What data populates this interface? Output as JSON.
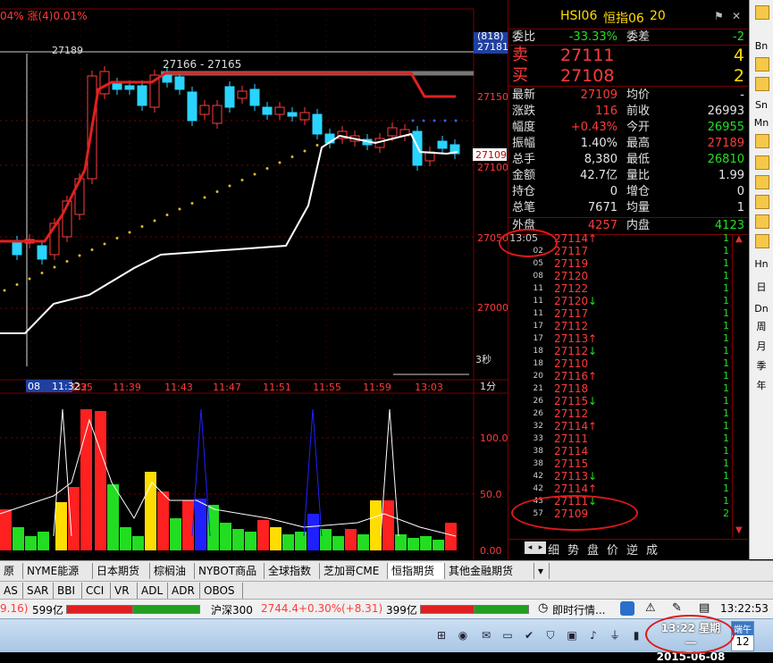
{
  "header": {
    "change_text": "04% 涨(4)0.01%"
  },
  "chart": {
    "price_labels": [
      "(818)",
      "27181",
      "27150",
      "27100",
      "27050",
      "27000"
    ],
    "current_price_tag": "27109",
    "high_annotation": "27189",
    "range_annotation": "27166 - 27165",
    "time_labels": [
      "11:32",
      "11:35",
      "11:39",
      "11:43",
      "11:47",
      "11:51",
      "11:55",
      "11:59",
      "13:03"
    ],
    "time_prefix": "08",
    "interval_label": "3秒",
    "period_label": "1分",
    "volume_labels": [
      "100.0",
      "50.0",
      "0.00"
    ]
  },
  "panel": {
    "symbol": "HSI06",
    "name": "恒指06",
    "number": "20",
    "weibi_label": "委比",
    "weibi_value": "-33.33%",
    "weicha_label": "委差",
    "weicha_value": "-2",
    "sell_label": "卖",
    "sell_price": "27111",
    "sell_qty": "4",
    "buy_label": "买",
    "buy_price": "27108",
    "buy_qty": "2",
    "rows": [
      {
        "l1": "最新",
        "v1": "27109",
        "c1": "red",
        "l2": "均价",
        "v2": "-",
        "c2": "white"
      },
      {
        "l1": "涨跌",
        "v1": "116",
        "c1": "red",
        "l2": "前收",
        "v2": "26993",
        "c2": "white"
      },
      {
        "l1": "幅度",
        "v1": "+0.43%",
        "c1": "red",
        "l2": "今开",
        "v2": "26955",
        "c2": "green"
      },
      {
        "l1": "振幅",
        "v1": "1.40%",
        "c1": "white",
        "l2": "最高",
        "v2": "27189",
        "c2": "red"
      },
      {
        "l1": "总手",
        "v1": "8,380",
        "c1": "white",
        "l2": "最低",
        "v2": "26810",
        "c2": "green"
      },
      {
        "l1": "金额",
        "v1": "42.7亿",
        "c1": "white",
        "l2": "量比",
        "v2": "1.99",
        "c2": "white"
      },
      {
        "l1": "持仓",
        "v1": "0",
        "c1": "white",
        "l2": "增仓",
        "v2": "0",
        "c2": "white"
      },
      {
        "l1": "总笔",
        "v1": "7671",
        "c1": "white",
        "l2": "均量",
        "v2": "1",
        "c2": "white"
      }
    ],
    "waipan_label": "外盘",
    "waipan_value": "4257",
    "neipan_label": "内盘",
    "neipan_value": "4123"
  },
  "ticks": [
    {
      "t": "13:05",
      "p": "27114",
      "a": "↑",
      "v": "1"
    },
    {
      "t": "02",
      "p": "27117",
      "a": "",
      "v": "1"
    },
    {
      "t": "05",
      "p": "27119",
      "a": "",
      "v": "1"
    },
    {
      "t": "08",
      "p": "27120",
      "a": "",
      "v": "1"
    },
    {
      "t": "11",
      "p": "27122",
      "a": "",
      "v": "1"
    },
    {
      "t": "11",
      "p": "27120",
      "a": "↓",
      "v": "1"
    },
    {
      "t": "11",
      "p": "27117",
      "a": "",
      "v": "1"
    },
    {
      "t": "17",
      "p": "27112",
      "a": "",
      "v": "1"
    },
    {
      "t": "17",
      "p": "27113",
      "a": "↑",
      "v": "1"
    },
    {
      "t": "18",
      "p": "27112",
      "a": "↓",
      "v": "1"
    },
    {
      "t": "18",
      "p": "27110",
      "a": "",
      "v": "1"
    },
    {
      "t": "20",
      "p": "27116",
      "a": "↑",
      "v": "1"
    },
    {
      "t": "21",
      "p": "27118",
      "a": "",
      "v": "1"
    },
    {
      "t": "26",
      "p": "27115",
      "a": "↓",
      "v": "1"
    },
    {
      "t": "26",
      "p": "27112",
      "a": "",
      "v": "1"
    },
    {
      "t": "32",
      "p": "27114",
      "a": "↑",
      "v": "1"
    },
    {
      "t": "33",
      "p": "27111",
      "a": "",
      "v": "1"
    },
    {
      "t": "38",
      "p": "27114",
      "a": "",
      "v": "1"
    },
    {
      "t": "38",
      "p": "27115",
      "a": "",
      "v": "1"
    },
    {
      "t": "42",
      "p": "27113",
      "a": "↓",
      "v": "1"
    },
    {
      "t": "42",
      "p": "27114",
      "a": "↑",
      "v": "1"
    },
    {
      "t": "43",
      "p": "27111",
      "a": "↓",
      "v": "1"
    },
    {
      "t": "57",
      "p": "27109",
      "a": "",
      "v": "2"
    }
  ],
  "panel_tabs": [
    "细",
    "势",
    "盘",
    "价",
    "逆",
    "成"
  ],
  "sidebar": [
    "Bn",
    "Sn",
    "Mn",
    "Hn",
    "日",
    "Dn",
    "周",
    "月",
    "季",
    "年"
  ],
  "market_tabs": [
    "原油",
    "NYME能源",
    "日本期货",
    "棕榈油",
    "NYBOT商品",
    "全球指数",
    "芝加哥CME",
    "恒指期货",
    "其他金融期货"
  ],
  "indicator_tabs": [
    "AS",
    "SAR",
    "BBI",
    "CCI",
    "VR",
    "ADL",
    "ADR",
    "OBOS"
  ],
  "status": {
    "left_val": "9.16)",
    "left_amt": "599亿",
    "index_name": "沪深300",
    "index_val": "2744.4",
    "index_chg": "+0.30%",
    "index_pts": "(+8.31)",
    "index_amt": "399亿",
    "news": "即时行情...",
    "time": "13:22:53"
  },
  "taskbar": {
    "clock_time": "13:22 星期一",
    "clock_date": "2015-06-08",
    "corner_text": "端午",
    "corner_num": "12"
  }
}
